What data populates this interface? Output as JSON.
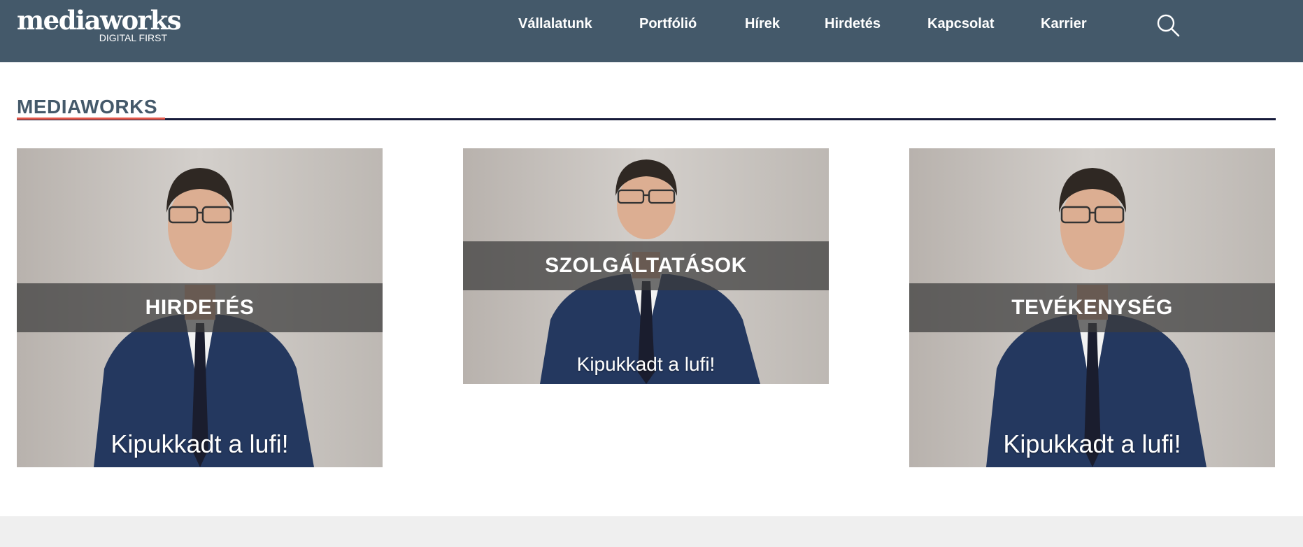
{
  "logo": {
    "main": "mediaworks",
    "sub": "DIGITAL FIRST"
  },
  "nav": {
    "items": [
      {
        "label": "Vállalatunk"
      },
      {
        "label": "Portfólió"
      },
      {
        "label": "Hírek"
      },
      {
        "label": "Hirdetés"
      },
      {
        "label": "Kapcsolat"
      },
      {
        "label": "Karrier"
      }
    ]
  },
  "colors": {
    "header_bg": "#44596a",
    "title_text": "#44596a",
    "title_accent": "#e4584a",
    "title_rule": "#161a3a",
    "footer_bg": "#efefef"
  },
  "section": {
    "title": "MEDIAWORKS"
  },
  "cards": [
    {
      "label": "HIRDETÉS",
      "caption": "Kipukkadt a lufi!"
    },
    {
      "label": "SZOLGÁLTATÁSOK",
      "caption": "Kipukkadt a lufi!"
    },
    {
      "label": "TEVÉKENYSÉG",
      "caption": "Kipukkadt a lufi!"
    }
  ],
  "icons": {
    "search": "search-icon"
  }
}
